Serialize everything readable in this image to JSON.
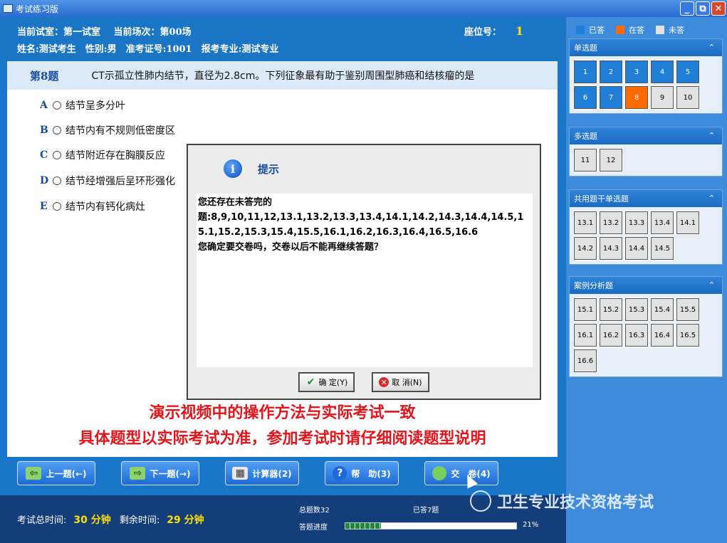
{
  "window": {
    "title": "考试练习版"
  },
  "header": {
    "room_label": "当前试室：第一试室",
    "session_label": "当前场次：第00场",
    "seat_label": "座位号：",
    "seat_value": "1",
    "candidate_line": "姓名:测试考生　性别:男　准考证号:1001　报考专业:测试专业"
  },
  "question": {
    "number": "第8题",
    "text": "CT示孤立性肺内结节，直径为2.8cm。下列征象最有助于鉴别周围型肺癌和结核瘤的是",
    "options": [
      {
        "letter": "A",
        "text": "结节呈多分叶"
      },
      {
        "letter": "B",
        "text": "结节内有不规则低密度区"
      },
      {
        "letter": "C",
        "text": "结节附近存在胸膜反应"
      },
      {
        "letter": "D",
        "text": "结节经增强后呈环形强化"
      },
      {
        "letter": "E",
        "text": "结节内有钙化病灶"
      }
    ]
  },
  "dialog": {
    "title": "提示",
    "line1": "您还存在未答完的",
    "line2": "题:8,9,10,11,12,13.1,13.2,13.3,13.4,14.1,14.2,14.3,14.4,14.5,15.1,15.2,15.3,15.4,15.5,16.1,16.2,16.3,16.4,16.5,16.6",
    "line3": "您确定要交卷吗，交卷以后不能再继续答题？",
    "ok_label": "确 定(Y)",
    "cancel_label": "取 消(N)"
  },
  "notice": {
    "line1": "演示视频中的操作方法与实际考试一致",
    "line2": "具体题型以实际考试为准，参加考试时请仔细阅读题型说明"
  },
  "toolbar": {
    "prev_label": "上一题(←)",
    "next_label": "下一题(→)",
    "calc_label": "计算器(2)",
    "help_label": "帮　助(3)",
    "submit_label": "交　卷(4)"
  },
  "status": {
    "total_time_label": "考试总时间:",
    "total_time_value": "30 分钟",
    "remain_label": "剩余时间:",
    "remain_value": "29 分钟",
    "total_count": "总题数32",
    "answered_count": "已答7题",
    "progress_label": "答题进度",
    "progress_pct": "21%",
    "progress_fraction": 0.21
  },
  "legend": {
    "answered": "已答",
    "current": "在答",
    "unanswered": "未答",
    "answered_color": "#1f7fd6",
    "current_color": "#ff6a00",
    "unanswered_color": "#e2e2e2"
  },
  "groups": [
    {
      "title": "单选题",
      "items": [
        "1",
        "2",
        "3",
        "4",
        "5",
        "6",
        "7",
        "8",
        "9",
        "10"
      ],
      "done": [
        "1",
        "2",
        "3",
        "4",
        "5",
        "6",
        "7"
      ],
      "current": "8"
    },
    {
      "title": "多选题",
      "items": [
        "11",
        "12"
      ],
      "done": [],
      "current": ""
    },
    {
      "title": "共用题干单选题",
      "items": [
        "13.1",
        "13.2",
        "13.3",
        "13.4",
        "14.1",
        "14.2",
        "14.3",
        "14.4",
        "14.5"
      ],
      "done": [],
      "current": ""
    },
    {
      "title": "案例分析题",
      "items": [
        "15.1",
        "15.2",
        "15.3",
        "15.4",
        "15.5",
        "16.1",
        "16.2",
        "16.3",
        "16.4",
        "16.5",
        "16.6"
      ],
      "done": [],
      "current": ""
    }
  ],
  "watermark": {
    "text": "卫生专业技术资格考试"
  }
}
